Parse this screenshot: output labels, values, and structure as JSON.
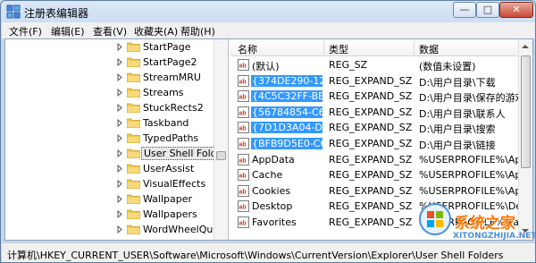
{
  "window": {
    "title": "注册表编辑器",
    "controls": {
      "minimize": "—",
      "maximize": "□",
      "close": "✕"
    }
  },
  "menu": [
    "文件(F)",
    "编辑(E)",
    "查看(V)",
    "收藏夹(A)",
    "帮助(H)"
  ],
  "tree": {
    "items": [
      {
        "label": "StartPage",
        "selected": false
      },
      {
        "label": "StartPage2",
        "selected": false
      },
      {
        "label": "StreamMRU",
        "selected": false
      },
      {
        "label": "Streams",
        "selected": false
      },
      {
        "label": "StuckRects2",
        "selected": false
      },
      {
        "label": "Taskband",
        "selected": false
      },
      {
        "label": "TypedPaths",
        "selected": false
      },
      {
        "label": "User Shell Folders",
        "selected": true
      },
      {
        "label": "UserAssist",
        "selected": false
      },
      {
        "label": "VisualEffects",
        "selected": false
      },
      {
        "label": "Wallpaper",
        "selected": false
      },
      {
        "label": "Wallpapers",
        "selected": false
      },
      {
        "label": "WordWheelQuery",
        "selected": false
      }
    ]
  },
  "list": {
    "columns": {
      "name": "名称",
      "type": "类型",
      "data": "数据"
    },
    "rows": [
      {
        "icon": "string-value-icon",
        "name": "(默认)",
        "type": "REG_SZ",
        "data": "(数值未设置)",
        "selected": false
      },
      {
        "icon": "string-value-icon",
        "name": "{374DE290-12...",
        "type": "REG_EXPAND_SZ",
        "data": "D:\\用户目录\\下载",
        "selected": true
      },
      {
        "icon": "string-value-icon",
        "name": "{4C5C32FF-BB...",
        "type": "REG_EXPAND_SZ",
        "data": "D:\\用户目录\\保存的游戏",
        "selected": true
      },
      {
        "icon": "string-value-icon",
        "name": "{56784854-C6...",
        "type": "REG_EXPAND_SZ",
        "data": "D:\\用户目录\\联系人",
        "selected": true
      },
      {
        "icon": "string-value-icon",
        "name": "{7D1D3A04-DE...",
        "type": "REG_EXPAND_SZ",
        "data": "D:\\用户目录\\搜索",
        "selected": true
      },
      {
        "icon": "string-value-icon",
        "name": "{BFB9D5E0-C6...",
        "type": "REG_EXPAND_SZ",
        "data": "D:\\用户目录\\链接",
        "selected": true
      },
      {
        "icon": "string-value-icon",
        "name": "AppData",
        "type": "REG_EXPAND_SZ",
        "data": "%USERPROFILE%\\AppD",
        "selected": false
      },
      {
        "icon": "string-value-icon",
        "name": "Cache",
        "type": "REG_EXPAND_SZ",
        "data": "%USERPROFILE%\\AppD",
        "selected": false
      },
      {
        "icon": "string-value-icon",
        "name": "Cookies",
        "type": "REG_EXPAND_SZ",
        "data": "%USERPROFILE%\\AppD",
        "selected": false
      },
      {
        "icon": "string-value-icon",
        "name": "Desktop",
        "type": "REG_EXPAND_SZ",
        "data": "%USERPROFILE%\\Deskt",
        "selected": false
      },
      {
        "icon": "string-value-icon",
        "name": "Favorites",
        "type": "REG_EXPAND_SZ",
        "data": "%USERPROFILE%\\Favorit",
        "selected": false
      }
    ]
  },
  "status": "计算机\\HKEY_CURRENT_USER\\Software\\Microsoft\\Windows\\CurrentVersion\\Explorer\\User Shell Folders",
  "watermark": {
    "text": "系统之家",
    "url": "XITONGZHIJIA.NET"
  },
  "colors": {
    "selection": "#3399ff",
    "folder": "#f2c94c",
    "watermark": "#ff7800"
  }
}
